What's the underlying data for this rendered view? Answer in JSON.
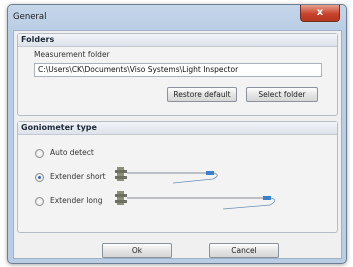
{
  "window": {
    "title": "General",
    "close_glyph": "x"
  },
  "folders": {
    "heading": "Folders",
    "field_label": "Measurement folder",
    "path_value": "C:\\Users\\CK\\Documents\\Viso Systems\\Light Inspector",
    "restore_label": "Restore default",
    "select_label": "Select folder"
  },
  "goniometer": {
    "heading": "Goniometer type",
    "options": [
      {
        "label": "Auto detect",
        "selected": false
      },
      {
        "label": "Extender short",
        "selected": true,
        "icon": "goniometer-short-icon"
      },
      {
        "label": "Extender long",
        "selected": false,
        "icon": "goniometer-long-icon"
      }
    ]
  },
  "footer": {
    "ok_label": "Ok",
    "cancel_label": "Cancel"
  },
  "colors": {
    "accent": "#2e6ab7",
    "close": "#c8442c",
    "frame": "#b9cde5"
  }
}
